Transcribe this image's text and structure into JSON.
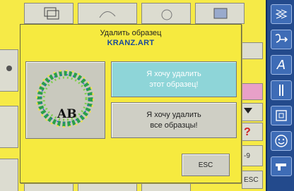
{
  "dialog": {
    "title": "Удалить образец",
    "filename": "KRANZ.ART",
    "delete_one_label": "Я хочу удалить\nэтот образец!",
    "delete_all_label": "Я хочу удалить\nвсе образцы!",
    "esc_label": "ESC",
    "preview_text": "AB"
  },
  "background": {
    "side_label_9": "-9",
    "side_label_esc": "ESC",
    "side_label_q": "?"
  },
  "toolbar": {
    "items": [
      {
        "name": "embroidery-pattern-icon"
      },
      {
        "name": "stitch-move-icon"
      },
      {
        "name": "alphabet-icon",
        "glyph": "A"
      },
      {
        "name": "column-stitch-icon"
      },
      {
        "name": "hoop-icon"
      },
      {
        "name": "smiley-icon"
      },
      {
        "name": "machine-icon"
      }
    ]
  },
  "colors": {
    "background_yellow": "#f6ea47",
    "toolbar_blue": "#234a8c",
    "highlight_cyan": "#8ed5d8",
    "filename_blue": "#1b4a9a"
  }
}
